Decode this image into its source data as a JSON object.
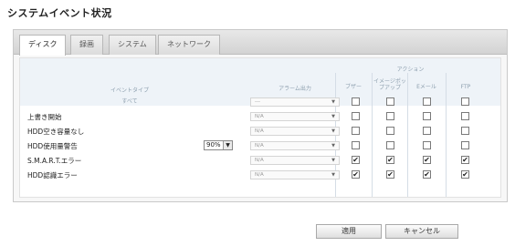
{
  "page": {
    "title": "システムイベント状況"
  },
  "tabs": [
    {
      "label": "ディスク",
      "active": true
    },
    {
      "label": "録画",
      "active": false
    },
    {
      "label": "システム",
      "active": false
    },
    {
      "label": "ネットワーク",
      "active": false
    }
  ],
  "table": {
    "action_group": "アクション",
    "col_event_type": "イベントタイプ",
    "col_alarm_out": "アラーム出力",
    "col_buzzer": "ブザー",
    "col_image_popup": "イメージポップアップ",
    "col_email": "Eメール",
    "col_ftp": "FTP",
    "all_label": "すべて",
    "all_alarm_value": "---",
    "rows": [
      {
        "label": "上書き開始",
        "alarm": "N/A",
        "buzzer": false,
        "popup": false,
        "email": false,
        "ftp": false
      },
      {
        "label": "HDD空き容量なし",
        "alarm": "N/A",
        "buzzer": false,
        "popup": false,
        "email": false,
        "ftp": false
      },
      {
        "label": "HDD使用量警告",
        "threshold": "90%",
        "alarm": "N/A",
        "buzzer": false,
        "popup": false,
        "email": false,
        "ftp": false
      },
      {
        "label": "S.M.A.R.T.エラー",
        "alarm": "N/A",
        "buzzer": true,
        "popup": true,
        "email": true,
        "ftp": true
      },
      {
        "label": "HDD認識エラー",
        "alarm": "N/A",
        "buzzer": true,
        "popup": true,
        "email": true,
        "ftp": true
      }
    ]
  },
  "buttons": {
    "apply": "適用",
    "cancel": "キャンセル"
  }
}
